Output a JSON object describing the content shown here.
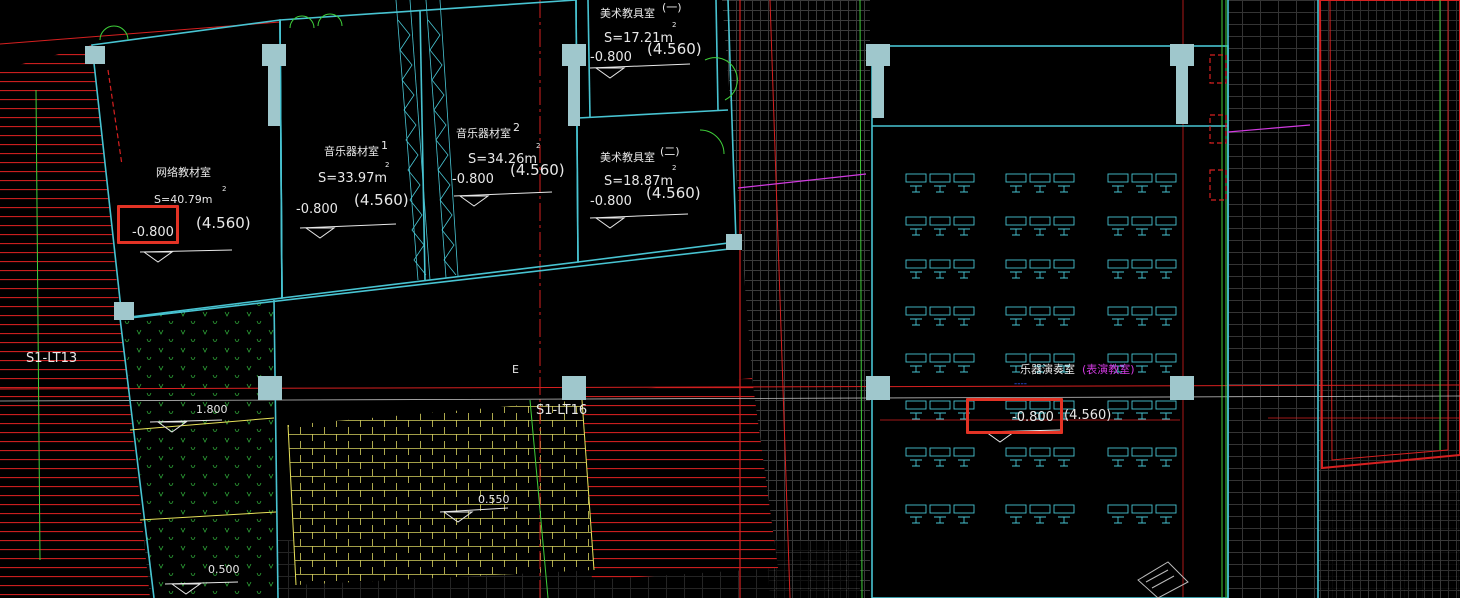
{
  "rooms": [
    {
      "name": "网络教材室",
      "area": "S=40.79m",
      "sup": "2",
      "level": "-0.800",
      "level2": "(4.560)"
    },
    {
      "name": "音乐器材室",
      "number": "1",
      "area": "S=33.97m",
      "sup": "2",
      "level": "-0.800",
      "level2": "(4.560)"
    },
    {
      "name": "音乐器材室",
      "number": "2",
      "area": "S=34.26m",
      "sup": "2",
      "level": "-0.800",
      "level2": "(4.560)"
    },
    {
      "name": "美术教具室",
      "number": "(一)",
      "area": "S=17.21m",
      "sup": "2",
      "level": "-0.800",
      "level2": "(4.560)"
    },
    {
      "name": "美术教具室",
      "number": "(二)",
      "area": "S=18.87m",
      "sup": "2",
      "level": "-0.800",
      "level2": "(4.560)"
    }
  ],
  "big_room": {
    "name": "乐器演奏室",
    "alt_name": "(表演教室)",
    "note": "----",
    "level": "-0.800",
    "level2": "(4.560)"
  },
  "spot_levels": {
    "a": "1.800",
    "b": "0.550",
    "c": "0.500"
  },
  "stair_labels": {
    "left": "S1-LT13",
    "mid": "S1-LT16",
    "grid_e": "E"
  },
  "colors": {
    "wall": "#48c4d2",
    "grid": "#d62020",
    "green": "#3fcf3a",
    "yellow": "#e8e25a",
    "magenta": "#d13ae0",
    "highlight": "#e33325"
  }
}
